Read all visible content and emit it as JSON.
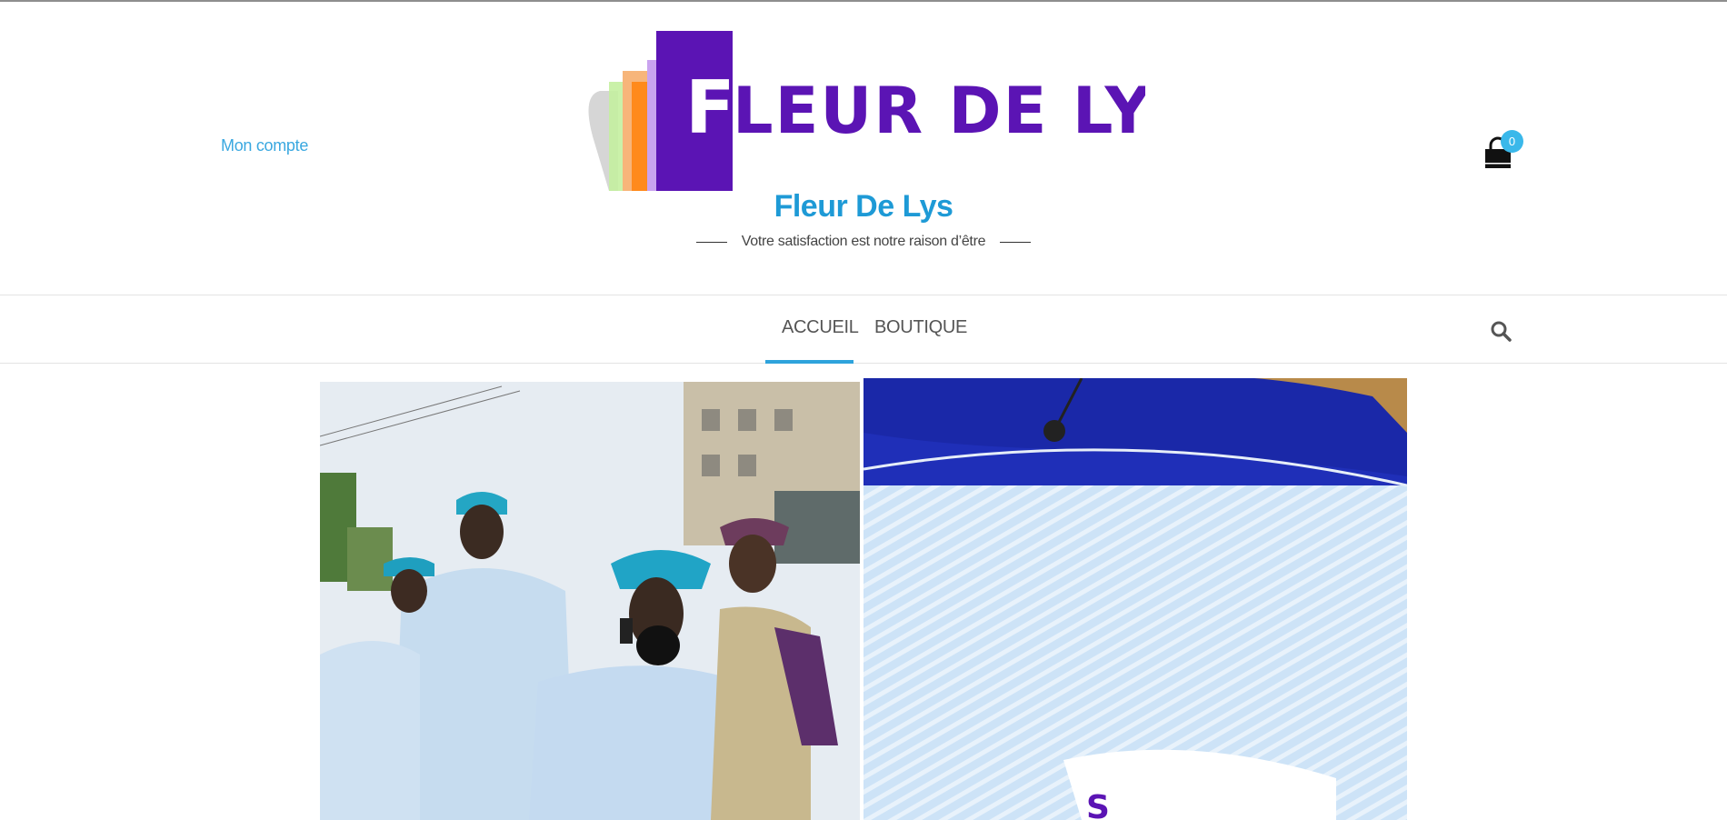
{
  "header": {
    "account_link": "Mon compte",
    "logo_text": "FLEUR DE LYS",
    "site_title": "Fleur De Lys",
    "tagline": "Votre satisfaction est notre raison d’être",
    "cart_count": "0",
    "cart_icon": "shopping-bag-icon"
  },
  "nav": {
    "items": [
      {
        "label": "ACCUEIL",
        "active": true
      },
      {
        "label": "BOUTIQUE",
        "active": false
      }
    ],
    "search_icon": "search-icon",
    "accent": "#2ea3dc"
  },
  "hero": {
    "left_image": "men-in-agbada-photo",
    "right_image": "striped-fabric-photo"
  },
  "colors": {
    "brand_blue": "#1e9ad6",
    "link_blue": "#3aa8e0",
    "logo_purple": "#5b14b4",
    "badge": "#3ab8ea"
  }
}
